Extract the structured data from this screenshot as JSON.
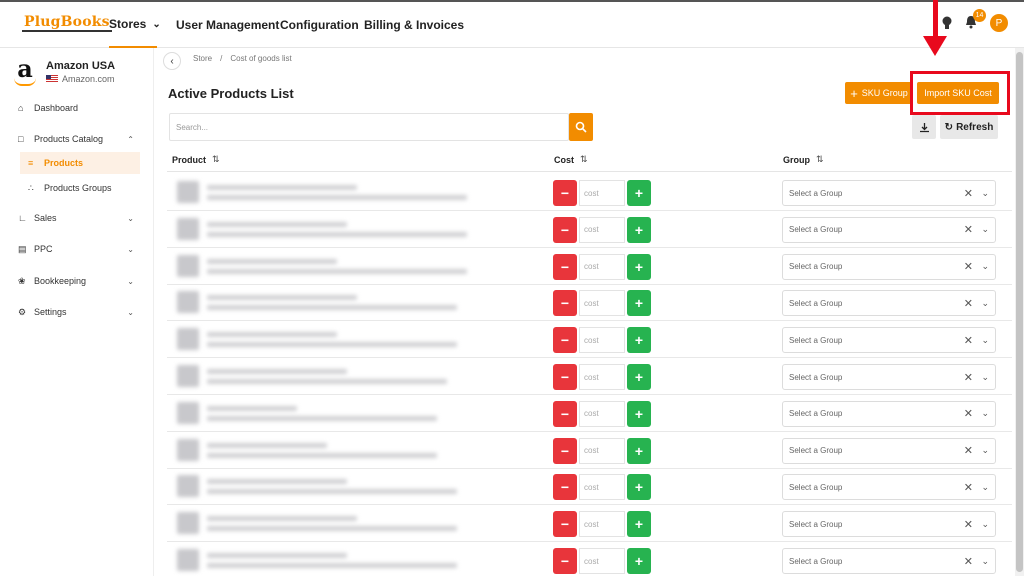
{
  "app": {
    "logo_plug": "Plug",
    "logo_books": "Books"
  },
  "topnav": [
    {
      "label": "Stores",
      "has_dropdown": true,
      "active": true
    },
    {
      "label": "User Management"
    },
    {
      "label": "Configuration"
    },
    {
      "label": "Billing & Invoices"
    }
  ],
  "notifications": {
    "count": "14"
  },
  "user": {
    "initial": "P"
  },
  "store": {
    "name": "Amazon USA",
    "url": "Amazon.com"
  },
  "sidebar": {
    "items": [
      {
        "label": "Dashboard",
        "icon": "home-icon"
      },
      {
        "label": "Products Catalog",
        "icon": "catalog-icon",
        "expanded": true
      },
      {
        "label": "Products",
        "icon": "list-icon",
        "active": true
      },
      {
        "label": "Products Groups",
        "icon": "groups-icon"
      },
      {
        "label": "Sales",
        "icon": "chart-icon"
      },
      {
        "label": "PPC",
        "icon": "ppc-icon"
      },
      {
        "label": "Bookkeeping",
        "icon": "bookkeeping-icon"
      },
      {
        "label": "Settings",
        "icon": "gear-icon"
      }
    ]
  },
  "breadcrumb": {
    "root": "Store",
    "sep": "/",
    "current": "Cost of goods list"
  },
  "page": {
    "title": "Active Products List"
  },
  "actions": {
    "sku_group": "SKU Group",
    "import_sku_cost": "Import SKU Cost",
    "refresh": "Refresh"
  },
  "search": {
    "placeholder": "Search..."
  },
  "table": {
    "headers": {
      "product": "Product",
      "cost": "Cost",
      "group": "Group"
    },
    "cost_placeholder": "cost",
    "group_placeholder": "Select a Group",
    "row_count": 11
  },
  "colors": {
    "accent": "#f28c00",
    "danger": "#e8353b",
    "success": "#27b350",
    "highlight": "#e8091d"
  }
}
